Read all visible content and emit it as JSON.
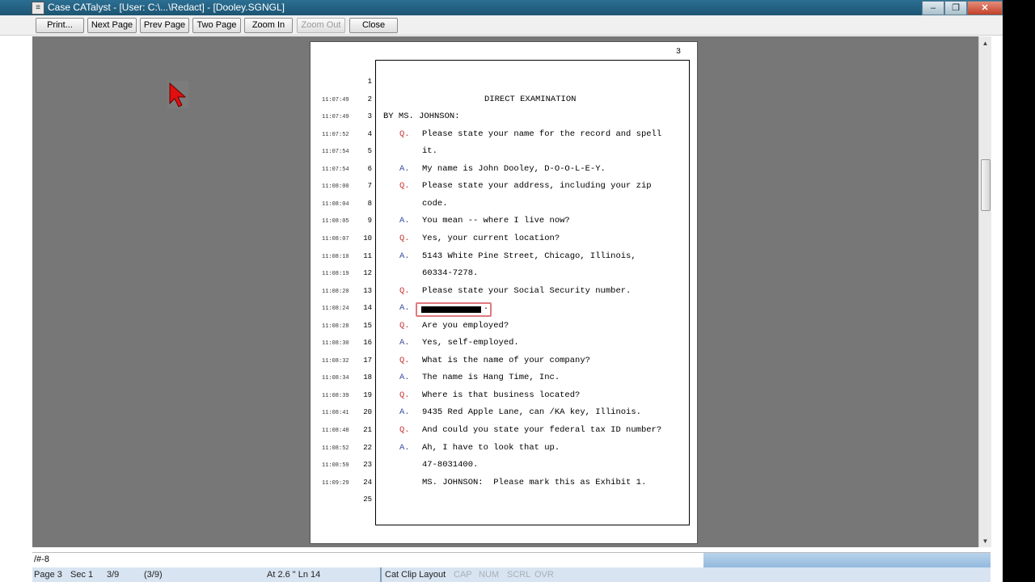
{
  "window": {
    "title": "Case CATalyst - [User: C:\\...\\Redact] - [Dooley.SGNGL]",
    "app_icon": "transcript-icon",
    "minimize": "–",
    "restore": "❐",
    "close": "✕"
  },
  "toolbar": {
    "print": "Print...",
    "next_page": "Next Page",
    "prev_page": "Prev Page",
    "two_page": "Two Page",
    "zoom_in": "Zoom In",
    "zoom_out": "Zoom Out",
    "close": "Close"
  },
  "page": {
    "number": "3",
    "lines": [
      {
        "time": "",
        "num": "1",
        "speaker": "",
        "text": "",
        "style": "normal"
      },
      {
        "time": "11:07:49",
        "num": "2",
        "speaker": "",
        "text": "DIRECT EXAMINATION",
        "style": "heading"
      },
      {
        "time": "11:07:49",
        "num": "3",
        "speaker": "",
        "text": "BY MS. JOHNSON:",
        "style": "by"
      },
      {
        "time": "11:07:52",
        "num": "4",
        "speaker": "Q.",
        "text": "Please state your name for the record and spell",
        "style": "normal"
      },
      {
        "time": "11:07:54",
        "num": "5",
        "speaker": "",
        "text": "it.",
        "style": "normal"
      },
      {
        "time": "11:07:54",
        "num": "6",
        "speaker": "A.",
        "text": "My name is John Dooley, D-O-O-L-E-Y.",
        "style": "normal"
      },
      {
        "time": "11:08:00",
        "num": "7",
        "speaker": "Q.",
        "text": "Please state your address, including your zip",
        "style": "normal"
      },
      {
        "time": "11:08:04",
        "num": "8",
        "speaker": "",
        "text": "code.",
        "style": "normal"
      },
      {
        "time": "11:08:05",
        "num": "9",
        "speaker": "A.",
        "text": "You mean -- where I live now?",
        "style": "normal"
      },
      {
        "time": "11:08:07",
        "num": "10",
        "speaker": "Q.",
        "text": "Yes, your current location?",
        "style": "normal"
      },
      {
        "time": "11:08:10",
        "num": "11",
        "speaker": "A.",
        "text": "5143 White Pine Street, Chicago, Illinois,",
        "style": "normal"
      },
      {
        "time": "11:08:19",
        "num": "12",
        "speaker": "",
        "text": "60334-7278.",
        "style": "normal"
      },
      {
        "time": "11:08:20",
        "num": "13",
        "speaker": "Q.",
        "text": "Please state your Social Security number.",
        "style": "normal"
      },
      {
        "time": "11:08:24",
        "num": "14",
        "speaker": "A.",
        "text": "",
        "style": "redacted"
      },
      {
        "time": "11:08:28",
        "num": "15",
        "speaker": "Q.",
        "text": "Are you employed?",
        "style": "normal"
      },
      {
        "time": "11:08:30",
        "num": "16",
        "speaker": "A.",
        "text": "Yes, self-employed.",
        "style": "normal"
      },
      {
        "time": "11:08:32",
        "num": "17",
        "speaker": "Q.",
        "text": "What is the name of your company?",
        "style": "normal"
      },
      {
        "time": "11:08:34",
        "num": "18",
        "speaker": "A.",
        "text": "The name is Hang Time, Inc.",
        "style": "normal"
      },
      {
        "time": "11:08:39",
        "num": "19",
        "speaker": "Q.",
        "text": "Where is that business located?",
        "style": "normal"
      },
      {
        "time": "11:08:41",
        "num": "20",
        "speaker": "A.",
        "text": "9435 Red Apple Lane, can /KA key, Illinois.",
        "style": "normal"
      },
      {
        "time": "11:08:48",
        "num": "21",
        "speaker": "Q.",
        "text": "And could you state your federal tax ID number?",
        "style": "normal"
      },
      {
        "time": "11:08:52",
        "num": "22",
        "speaker": "A.",
        "text": "Ah, I have to look that up.",
        "style": "normal"
      },
      {
        "time": "11:08:59",
        "num": "23",
        "speaker": "",
        "text": "47-8031400.",
        "style": "normal"
      },
      {
        "time": "11:09:29",
        "num": "24",
        "speaker": "",
        "text": "MS. JOHNSON:  Please mark this as Exhibit 1.",
        "style": "normal"
      },
      {
        "time": "",
        "num": "25",
        "speaker": "",
        "text": "",
        "style": "normal"
      }
    ],
    "redaction_end": "."
  },
  "command_bar": {
    "text": "/#-8"
  },
  "status": {
    "page": "Page 3",
    "sec": "Sec 1",
    "of": "3/9",
    "paren": "(3/9)",
    "position": "At 2.6 \" Ln 14",
    "layout": "Cat Clip Layout",
    "cap": "CAP",
    "num": "NUM",
    "scrl": "SCRL",
    "ovr": "OVR"
  },
  "colors": {
    "question_marker": "#cc3333",
    "answer_marker": "#3a4aa0",
    "redaction_outline": "#e07a80",
    "viewport_bg": "#777777"
  }
}
